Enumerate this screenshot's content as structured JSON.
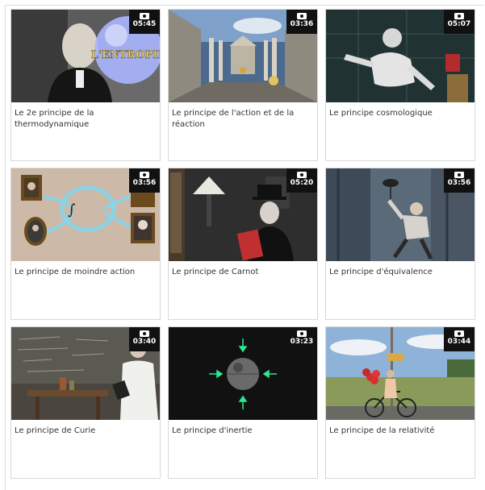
{
  "videos": [
    {
      "title": "Le 2e principe de la thermodynamique",
      "duration": "05:45",
      "thumb_text": "L'ENTROPIE",
      "thumb_icon": "scientist-bubble"
    },
    {
      "title": "Le principe de l'action et de la réaction",
      "duration": "03:36",
      "thumb_text": "",
      "thumb_icon": "greek-temple"
    },
    {
      "title": "Le principe cosmologique",
      "duration": "05:07",
      "thumb_text": "",
      "thumb_icon": "astronaut"
    },
    {
      "title": "Le principe de moindre action",
      "duration": "03:56",
      "thumb_text": "",
      "thumb_icon": "integral-portraits"
    },
    {
      "title": "Le principe de Carnot",
      "duration": "05:20",
      "thumb_text": "",
      "thumb_icon": "man-top-hat"
    },
    {
      "title": "Le principe d'équivalence",
      "duration": "03:56",
      "thumb_text": "",
      "thumb_icon": "falling-man"
    },
    {
      "title": "Le principe de Curie",
      "duration": "03:40",
      "thumb_text": "",
      "thumb_icon": "chalkboard-scientist"
    },
    {
      "title": "Le principe d'inertie",
      "duration": "03:23",
      "thumb_text": "",
      "thumb_icon": "sphere-arrows"
    },
    {
      "title": "Le principe de la relativité",
      "duration": "03:44",
      "thumb_text": "",
      "thumb_icon": "woman-bicycle"
    }
  ],
  "badge_icon": "video-camera-icon",
  "colors": {
    "badge_bg": "#111111",
    "arrow_green": "#2ee88f",
    "card_border": "#d8d8d8"
  }
}
